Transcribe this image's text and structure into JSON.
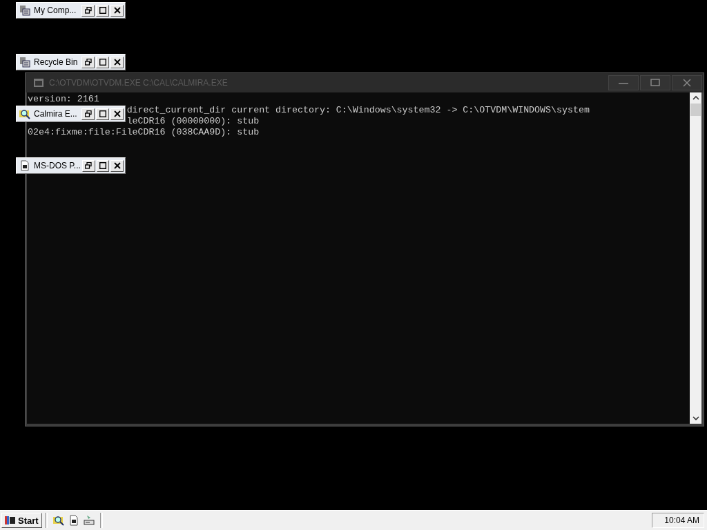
{
  "minimized_windows": [
    {
      "title": "My Comp...",
      "kind": "computer"
    },
    {
      "title": "Recycle Bin",
      "kind": "computer"
    },
    {
      "title": "Calmira E...",
      "kind": "magnifier"
    },
    {
      "title": "MS-DOS P...",
      "kind": "document"
    }
  ],
  "console": {
    "title": "C:\\OTVDM\\OTVDM.EXE C:\\CAL\\CALMIRA.EXE",
    "active": false,
    "lines": [
      {
        "kind": "full",
        "text": "version: 2161"
      },
      {
        "kind": "cut",
        "text": "direct_current_dir current directory: C:\\Windows\\system32 -> C:\\OTVDM\\WINDOWS\\system"
      },
      {
        "kind": "cut",
        "text": "leCDR16 (00000000): stub"
      },
      {
        "kind": "full",
        "text": "02e4:fixme:file:FileCDR16 (038CAA9D): stub"
      }
    ]
  },
  "taskbar": {
    "start": "Start",
    "clock": "10:04 AM"
  }
}
